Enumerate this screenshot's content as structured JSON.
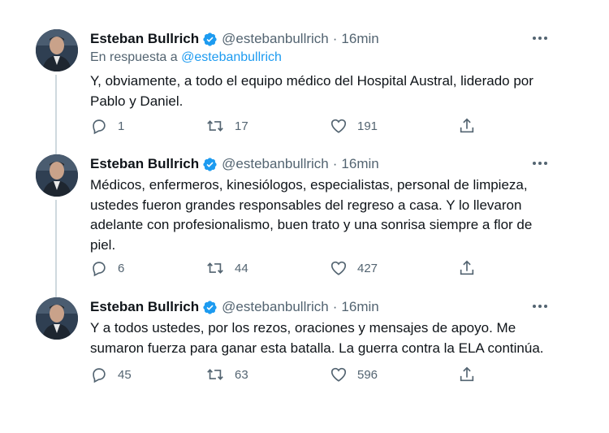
{
  "tweets": [
    {
      "author": "Esteban Bullrich",
      "handle": "@estebanbullrich",
      "separator": "·",
      "time": "16min",
      "reply_prefix": "En respuesta a",
      "reply_mention": "@estebanbullrich",
      "text": "Y, obviamente, a todo el equipo médico del Hospital Austral, liderado por\nPablo y Daniel.",
      "replies": "1",
      "retweets": "17",
      "likes": "191"
    },
    {
      "author": "Esteban Bullrich",
      "handle": "@estebanbullrich",
      "separator": "·",
      "time": "16min",
      "text": "Médicos, enfermeros, kinesiólogos, especialistas, personal de limpieza,\nustedes fueron grandes responsables del regreso a casa. Y lo llevaron\nadelante con profesionalismo, buen trato y una sonrisa siempre a flor de\npiel.",
      "replies": "6",
      "retweets": "44",
      "likes": "427"
    },
    {
      "author": "Esteban Bullrich",
      "handle": "@estebanbullrich",
      "separator": "·",
      "time": "16min",
      "text": "Y a todos ustedes, por los rezos, oraciones y mensajes de apoyo. Me\nsumaron fuerza para ganar esta batalla. La guerra contra la ELA continúa.",
      "replies": "45",
      "retweets": "63",
      "likes": "596"
    }
  ],
  "colors": {
    "verified": "#1d9bf0",
    "mention": "#1d9bf0",
    "secondary_text": "#536471",
    "thread_line": "#cfd9de"
  },
  "icons": [
    "verified-badge-icon",
    "more-icon",
    "reply-icon",
    "retweet-icon",
    "like-icon",
    "share-icon"
  ]
}
